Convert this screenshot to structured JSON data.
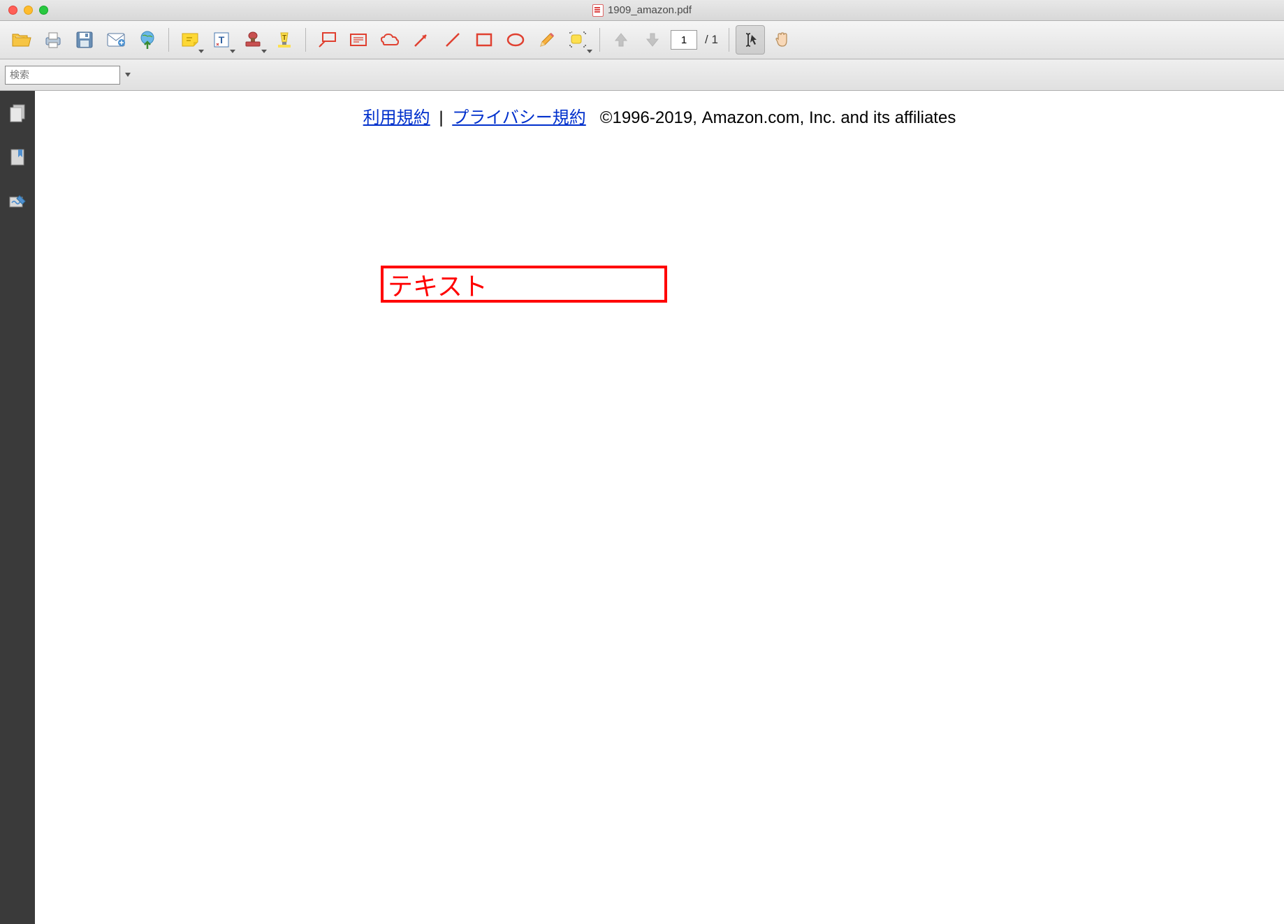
{
  "window": {
    "title": "1909_amazon.pdf"
  },
  "toolbar": {
    "page_current": "1",
    "page_total": "/ 1"
  },
  "search": {
    "placeholder": "検索"
  },
  "document": {
    "link_terms": "利用規約",
    "separator": "|",
    "link_privacy": "プライバシー規約",
    "copyright": "©1996-2019, Amazon.com, Inc. and its affiliates"
  },
  "annotation": {
    "text": "テキスト"
  }
}
